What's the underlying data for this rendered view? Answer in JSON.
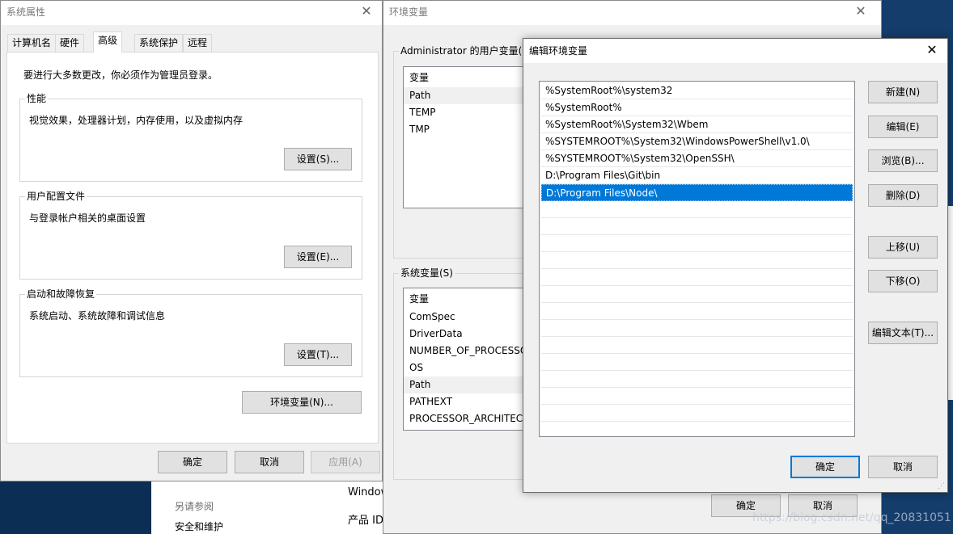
{
  "sys_props": {
    "title": "系统属性",
    "tabs": [
      "计算机名",
      "硬件",
      "高级",
      "系统保护",
      "远程"
    ],
    "notice": "要进行大多数更改，你必须作为管理员登录。",
    "groups": [
      {
        "label": "性能",
        "desc": "视觉效果，处理器计划，内存使用，以及虚拟内存",
        "button": "设置(S)..."
      },
      {
        "label": "用户配置文件",
        "desc": "与登录帐户相关的桌面设置",
        "button": "设置(E)..."
      },
      {
        "label": "启动和故障恢复",
        "desc": "系统启动、系统故障和调试信息",
        "button": "设置(T)..."
      }
    ],
    "env_button": "环境变量(N)...",
    "ok": "确定",
    "cancel": "取消",
    "apply": "应用(A)"
  },
  "env_vars": {
    "title": "环境变量",
    "user_group": "Administrator 的用户变量(U)",
    "user_header": "变量",
    "user_vars": [
      "Path",
      "TEMP",
      "TMP"
    ],
    "sys_group": "系统变量(S)",
    "sys_header": "变量",
    "sys_vars": [
      "ComSpec",
      "DriverData",
      "NUMBER_OF_PROCESSORS",
      "OS",
      "Path",
      "PATHEXT",
      "PROCESSOR_ARCHITECT"
    ],
    "ok": "确定",
    "cancel": "取消"
  },
  "edit_env": {
    "title": "编辑环境变量",
    "paths": [
      "%SystemRoot%\\system32",
      "%SystemRoot%",
      "%SystemRoot%\\System32\\Wbem",
      "%SYSTEMROOT%\\System32\\WindowsPowerShell\\v1.0\\",
      "%SYSTEMROOT%\\System32\\OpenSSH\\",
      "D:\\Program Files\\Git\\bin",
      "D:\\Program Files\\Node\\"
    ],
    "selected_index": 6,
    "empty_rows": 14,
    "buttons": {
      "new": "新建(N)",
      "edit": "编辑(E)",
      "browse": "浏览(B)...",
      "delete": "删除(D)",
      "up": "上移(U)",
      "down": "下移(O)",
      "edit_text": "编辑文本(T)..."
    },
    "ok": "确定",
    "cancel": "取消"
  },
  "background": {
    "see_also": "另请参阅",
    "security": "安全和维护",
    "windows": "Windows",
    "product_id": "产品 ID:",
    "watermark": "https://blog.csdn.net/qq_20831051"
  }
}
